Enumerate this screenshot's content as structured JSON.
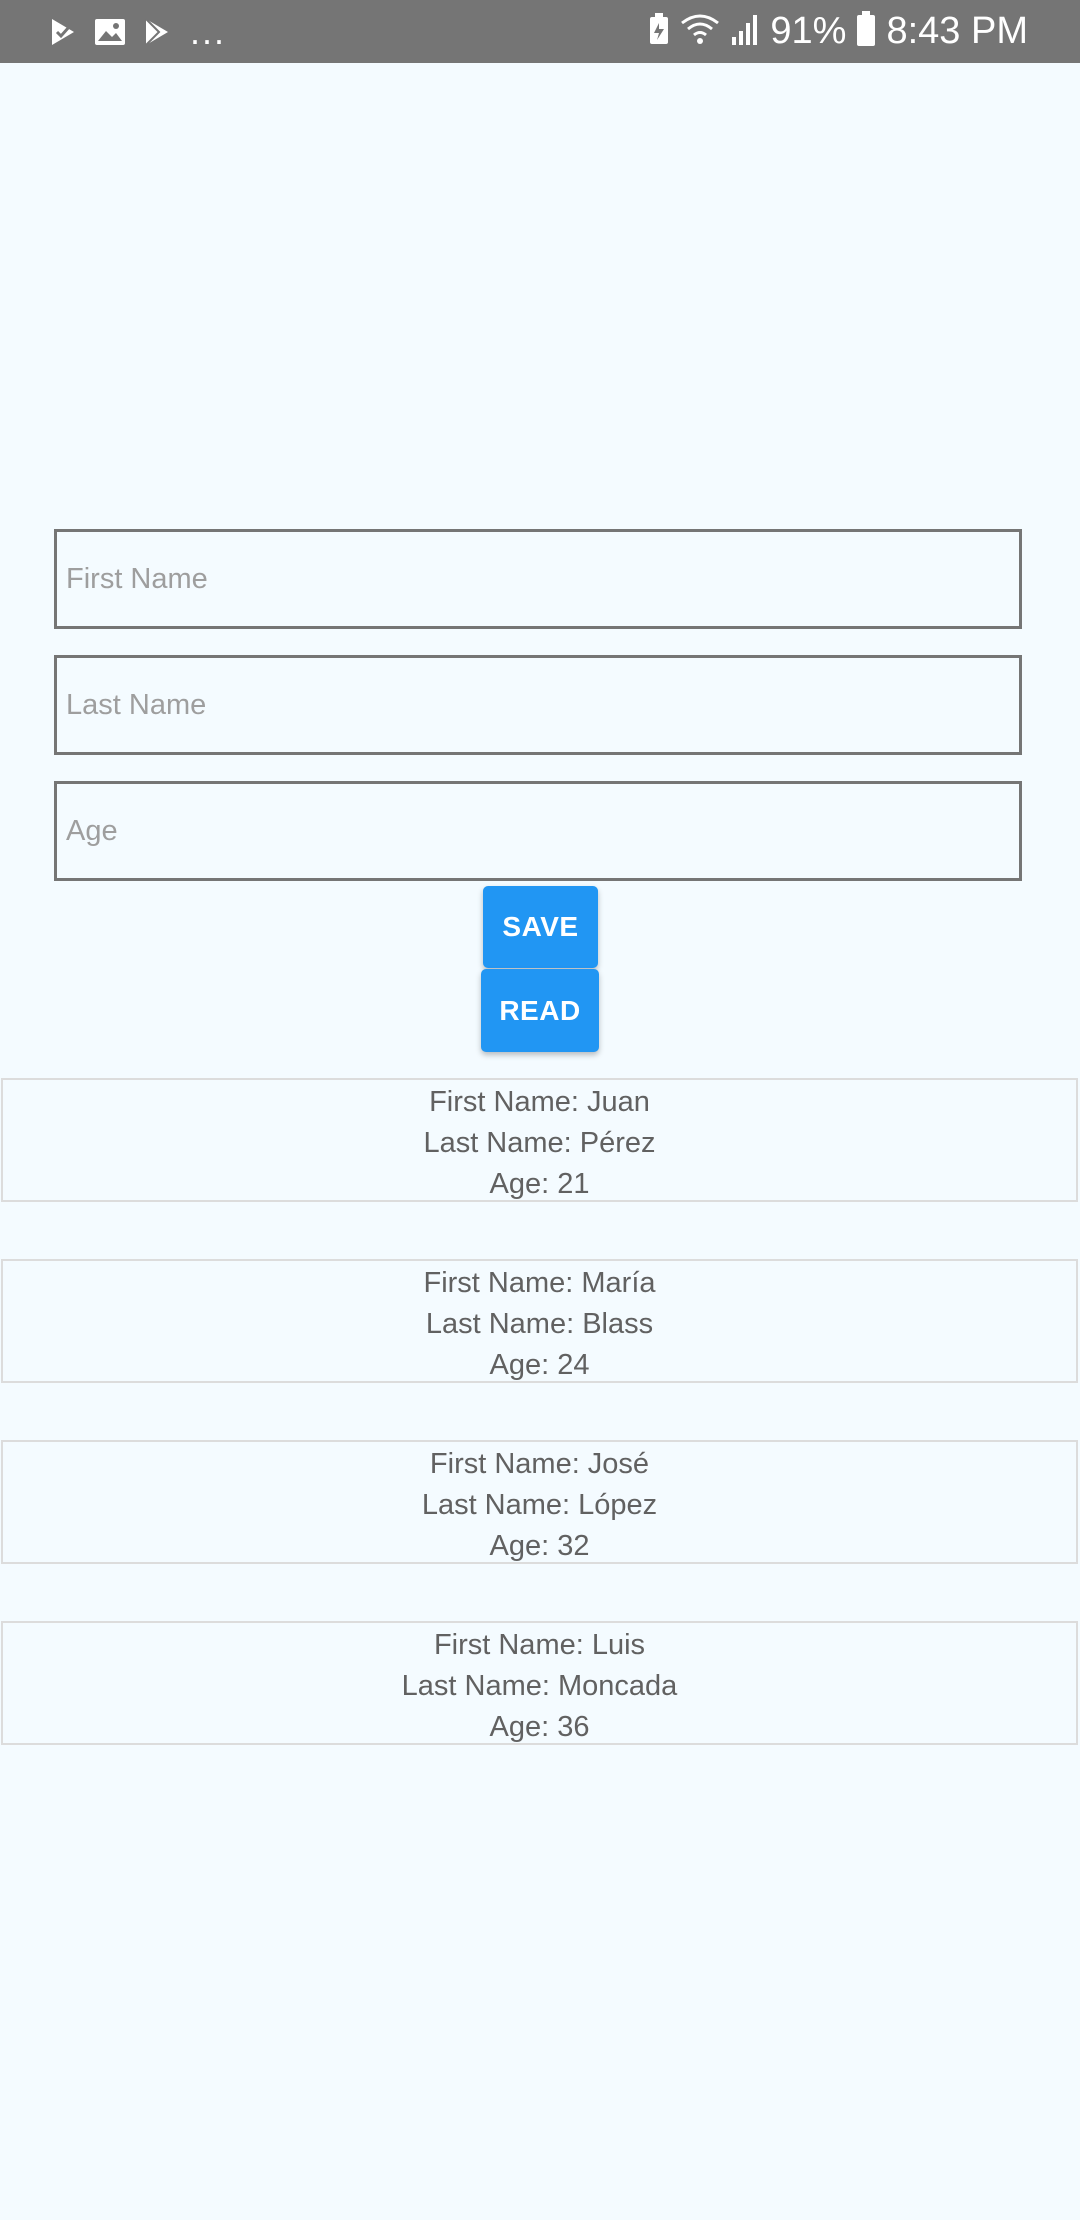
{
  "status_bar": {
    "icons_left": [
      "play-store-check-icon",
      "image-icon",
      "play-store-icon"
    ],
    "more": "...",
    "icons_right": [
      "battery-saver-icon",
      "wifi-icon",
      "signal-icon",
      "battery-icon"
    ],
    "battery": "91%",
    "time": "8:43 PM"
  },
  "form": {
    "first_name": {
      "value": "",
      "placeholder": "First Name"
    },
    "last_name": {
      "value": "",
      "placeholder": "Last Name"
    },
    "age": {
      "value": "",
      "placeholder": "Age"
    },
    "save_label": "SAVE",
    "read_label": "READ"
  },
  "records": [
    {
      "first": "First Name: Juan",
      "last": "Last Name: Pérez",
      "age": "Age: 21"
    },
    {
      "first": "First Name: María",
      "last": "Last Name: Blass",
      "age": "Age: 24"
    },
    {
      "first": "First Name: José",
      "last": "Last Name: López",
      "age": "Age: 32"
    },
    {
      "first": "First Name: Luis",
      "last": "Last Name: Moncada",
      "age": "Age: 36"
    }
  ],
  "colors": {
    "status_bar": "#757575",
    "background": "#f4fbff",
    "button": "#2196f3",
    "field_border": "#757575",
    "card_border": "#dcdcdc",
    "text": "#616161"
  }
}
